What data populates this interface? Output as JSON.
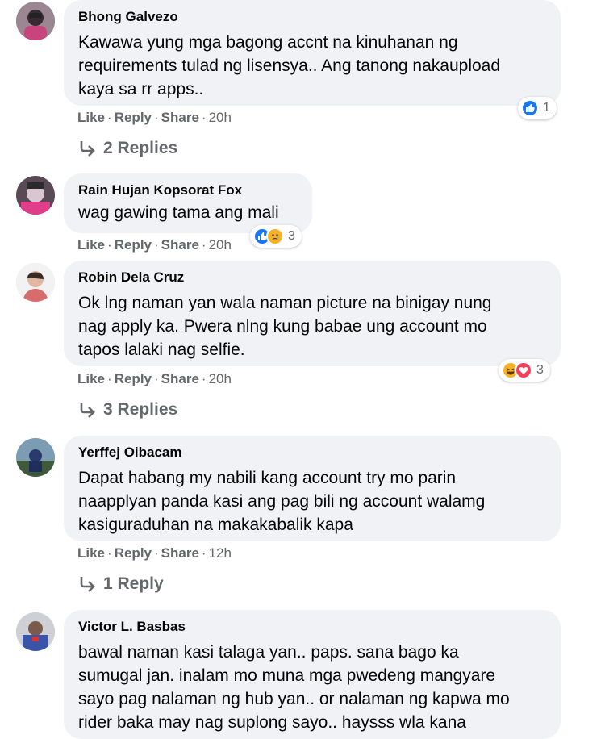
{
  "comments": [
    {
      "author": "Bhong Galvezo",
      "lines": [
        "Kawawa yung mga bagong accnt na kinuhanan ng",
        "requirements tulad ng lisensya.. Ang tanong nakaupload",
        "kaya sa rr apps.."
      ],
      "actions": {
        "like": "Like",
        "reply": "Reply",
        "share": "Share",
        "time": "20h"
      },
      "reactions": {
        "icons": [
          "like-icon"
        ],
        "count": "1"
      },
      "replies_label": "2 Replies"
    },
    {
      "author": "Rain Hujan Kopsorat Fox",
      "lines": [
        "wag gawing tama ang mali"
      ],
      "actions": {
        "like": "Like",
        "reply": "Reply",
        "share": "Share",
        "time": "20h"
      },
      "reactions": {
        "icons": [
          "like-icon",
          "sad-icon"
        ],
        "count": "3"
      }
    },
    {
      "author": "Robin Dela Cruz",
      "lines": [
        "Ok lng naman yan wala naman picture na binigay nung",
        "nag apply ka. Pwera nlng kung babae ung account mo",
        "tapos lalaki nag selfie."
      ],
      "actions": {
        "like": "Like",
        "reply": "Reply",
        "share": "Share",
        "time": "20h"
      },
      "reactions": {
        "icons": [
          "haha-icon",
          "love-icon"
        ],
        "count": "3"
      },
      "replies_label": "3 Replies"
    },
    {
      "author": "Yerffej Oibacam",
      "lines": [
        "Dapat habang my nabili kang account try mo parin",
        "naapplyan panda kasi ang pag bili ng account walamg",
        "kasiguraduhan na makakabalik kapa"
      ],
      "actions": {
        "like": "Like",
        "reply": "Reply",
        "share": "Share",
        "time": "12h"
      },
      "replies_label": "1 Reply"
    },
    {
      "author": "Victor L. Basbas",
      "lines": [
        "bawal naman kasi talaga yan.. paps. sana bago ka",
        "sumugal jan. inalam mo muna mga pwedeng mangyare",
        "sayo pag nalaman ng hub yan.. or nalaman ng kapwa mo",
        "rider baka may nag suplong sayo.. haysss wla kana"
      ]
    }
  ],
  "colors": {
    "like": "#1877f2",
    "love": "#f33e58",
    "haha": "#f7b125",
    "bubble": "#f0f2f5",
    "meta": "#65676b"
  }
}
